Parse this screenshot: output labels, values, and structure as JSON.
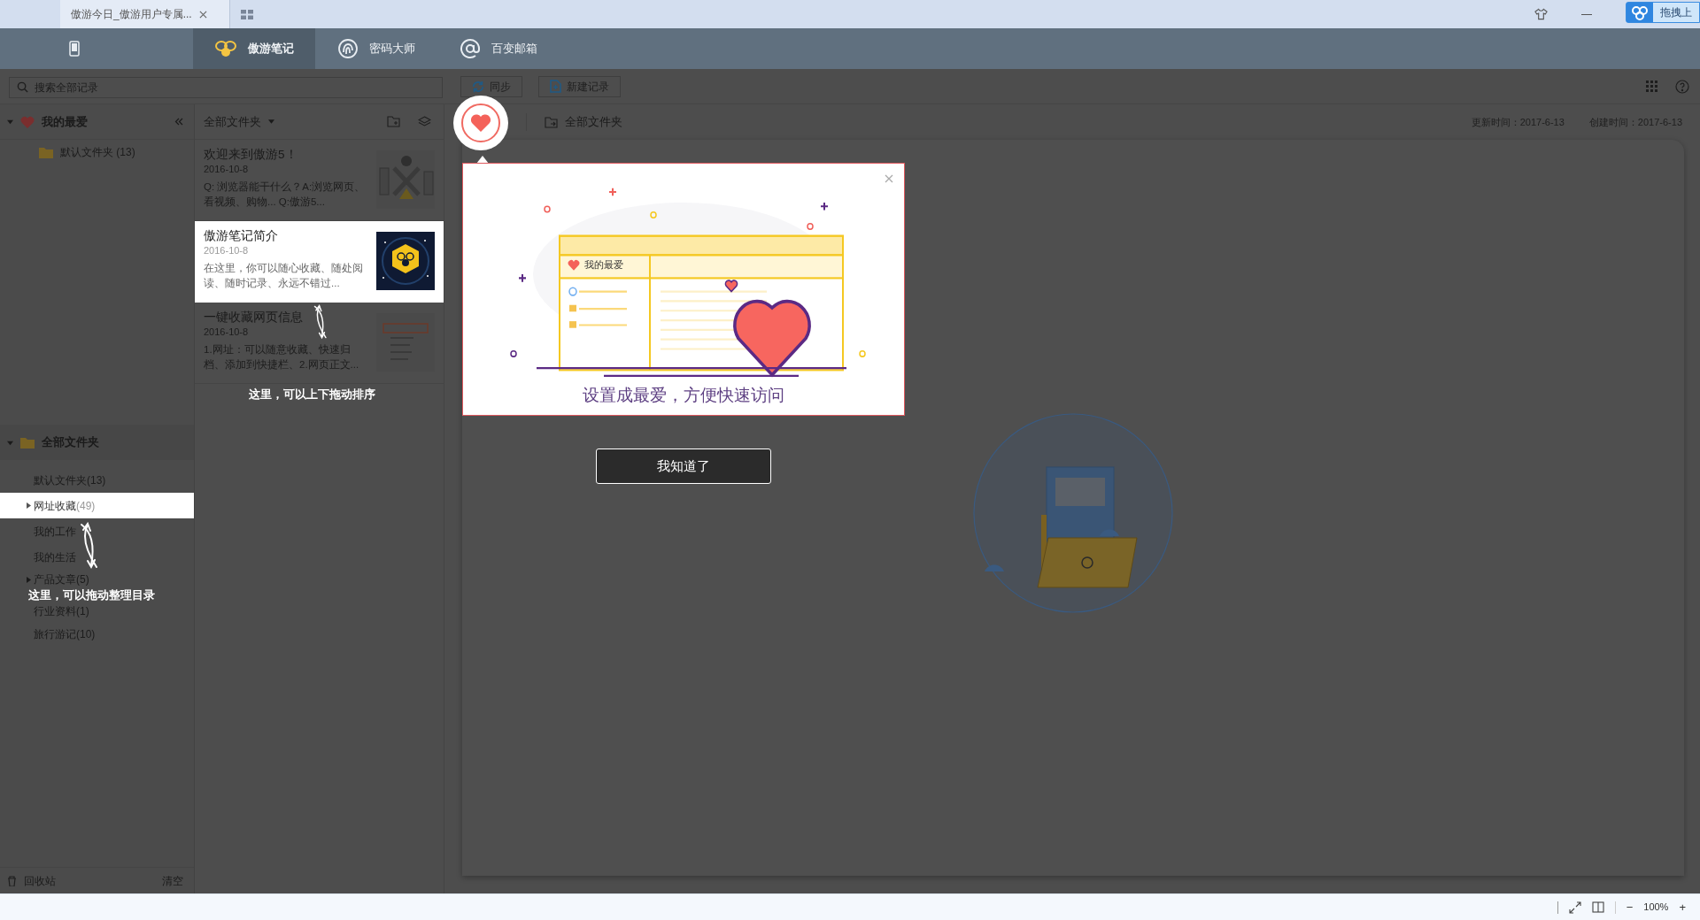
{
  "browser_tabs": [
    {
      "title": "傲游今日_傲游用户专属...",
      "selected": true
    }
  ],
  "cloud_button": "拖拽上",
  "nav": [
    {
      "kind": "bee",
      "label": "傲游笔记",
      "selected": true
    },
    {
      "kind": "fingerprint",
      "label": "密码大师",
      "selected": false
    },
    {
      "kind": "mail",
      "label": "百变邮箱",
      "selected": false
    }
  ],
  "toolbar": {
    "search_placeholder": "搜索全部记录",
    "buttons": [
      {
        "kind": "sync",
        "label": "同步"
      },
      {
        "kind": "new",
        "label": "新建记录"
      }
    ]
  },
  "favorites": {
    "title": "我的最爱",
    "expanded": true,
    "items": [
      {
        "name": "默认文件夹",
        "count": "(13)"
      }
    ]
  },
  "folders": {
    "title": "全部文件夹",
    "expanded": true,
    "items": [
      {
        "name": "默认文件夹",
        "count": "(13)",
        "selected": false,
        "has_children": false
      },
      {
        "name": "网址收藏",
        "count": "(49)",
        "selected": true,
        "has_children": true
      },
      {
        "name": "我的工作",
        "selected": false,
        "has_children": false
      },
      {
        "name": "我的生活",
        "selected": false,
        "has_children": false
      },
      {
        "name": "产品文章",
        "count": "(5)",
        "selected": false,
        "has_children": true
      },
      {
        "name": "行业资料",
        "count": "(1)",
        "selected": false,
        "has_children": false
      },
      {
        "name": "旅行游记",
        "count": "(10)",
        "selected": false,
        "has_children": false
      }
    ]
  },
  "sidebar_hint": "这里，可以拖动整理目录",
  "trash": {
    "label": "回收站",
    "clear": "清空"
  },
  "note_list": {
    "folder": "全部文件夹",
    "notes": [
      {
        "title": "欢迎来到傲游5！",
        "date": "2016-10-8",
        "snippet": "Q: 浏览器能干什么？A:浏览网页、看视频、购物... Q:傲游5...",
        "selected": false,
        "kind": "people"
      },
      {
        "title": "傲游笔记简介",
        "date": "2016-10-8",
        "snippet": "在这里，你可以随心收藏、随处阅读、随时记录、永远不错过...",
        "selected": true,
        "kind": "logo"
      },
      {
        "title": "一键收藏网页信息",
        "date": "2016-10-8",
        "snippet": "1.网址：可以随意收藏、快速归档、添加到快捷栏、2.网页正文...",
        "selected": false,
        "kind": "menu"
      }
    ]
  },
  "list_hint": "这里，可以上下拖动排序",
  "editor": {
    "folder": "全部文件夹",
    "updated": "更新时间：2017-6-13",
    "created": "创建时间：2017-6-13"
  },
  "guide": {
    "illustration_label": "我的最爱",
    "caption": "设置成最爱，方便快速访问",
    "button": "我知道了"
  },
  "status_bar": {
    "minus": "−",
    "zoom": "100%",
    "plus": "+"
  }
}
